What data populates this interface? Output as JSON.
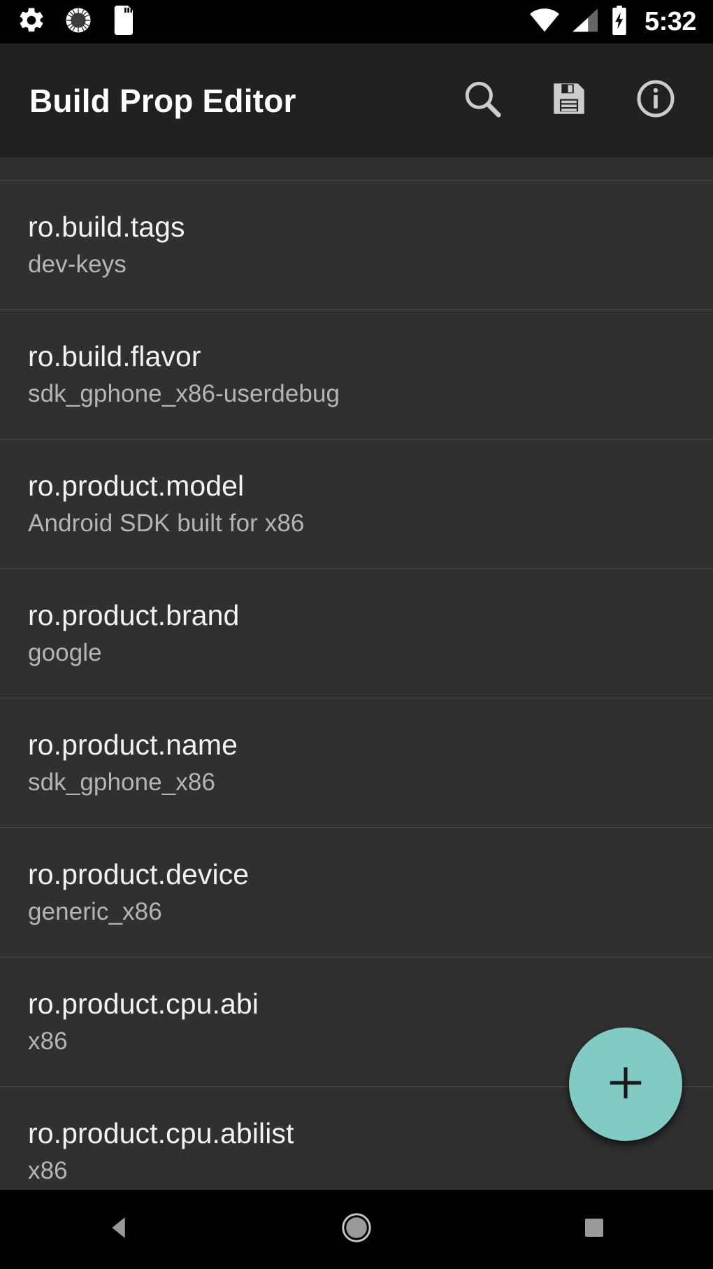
{
  "status_bar": {
    "left_icons": [
      {
        "name": "settings-gear-icon",
        "label": "gear-icon"
      },
      {
        "name": "sunburst-circle-icon",
        "label": "sunburst-icon"
      },
      {
        "name": "sd-card-icon",
        "label": "sd-card-icon"
      }
    ],
    "right_icons": [
      {
        "name": "wifi-icon",
        "label": "wifi-full"
      },
      {
        "name": "cellular-signal-icon",
        "label": "signal-partial"
      },
      {
        "name": "battery-charging-icon",
        "label": "battery-charging"
      }
    ],
    "time": "5:32"
  },
  "app_bar": {
    "title": "Build Prop Editor",
    "actions": [
      {
        "name": "search-icon",
        "label": "Search"
      },
      {
        "name": "save-icon",
        "label": "Save"
      },
      {
        "name": "info-icon",
        "label": "Info"
      }
    ]
  },
  "list": {
    "rows": [
      {
        "key": "ro.build.tags",
        "value": "dev-keys"
      },
      {
        "key": "ro.build.flavor",
        "value": "sdk_gphone_x86-userdebug"
      },
      {
        "key": "ro.product.model",
        "value": "Android SDK built for x86"
      },
      {
        "key": "ro.product.brand",
        "value": "google"
      },
      {
        "key": "ro.product.name",
        "value": "sdk_gphone_x86"
      },
      {
        "key": "ro.product.device",
        "value": "generic_x86"
      },
      {
        "key": "ro.product.cpu.abi",
        "value": "x86"
      },
      {
        "key": "ro.product.cpu.abilist",
        "value": "x86"
      }
    ]
  },
  "fab": {
    "name": "add-property-button",
    "label": "+",
    "color": "#81cbc4"
  },
  "nav_bar": {
    "buttons": [
      {
        "name": "nav-back-button",
        "label": "Back"
      },
      {
        "name": "nav-home-button",
        "label": "Home"
      },
      {
        "name": "nav-recents-button",
        "label": "Recents"
      }
    ]
  },
  "colors": {
    "status_bar_bg": "#000000",
    "app_bar_bg": "#212121",
    "list_bg": "#303030",
    "divider": "#4a4a4a",
    "key_text": "#f2f2f2",
    "value_text": "#b5b5b5",
    "accent": "#81cbc4"
  }
}
